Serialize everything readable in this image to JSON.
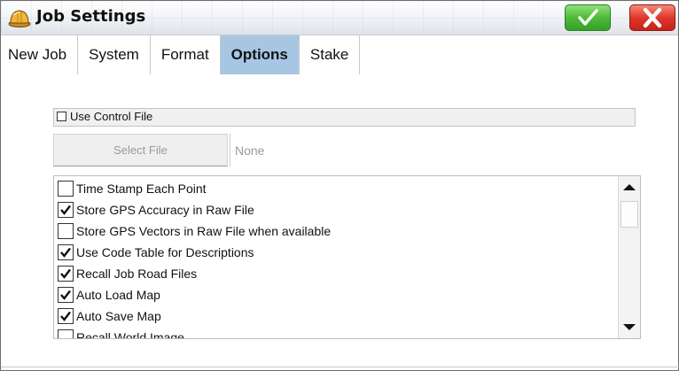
{
  "window": {
    "title": "Job Settings",
    "app_icon": "hard-hat-icon",
    "ok_icon": "checkmark-icon",
    "cancel_icon": "close-x-icon",
    "colors": {
      "ok": "#4fbb36",
      "cancel": "#e0372b",
      "active_tab": "#a7c6e3"
    }
  },
  "tabs": [
    {
      "label": "New Job",
      "active": false
    },
    {
      "label": "System",
      "active": false
    },
    {
      "label": "Format",
      "active": false
    },
    {
      "label": "Options",
      "active": true
    },
    {
      "label": "Stake",
      "active": false
    }
  ],
  "control_file": {
    "label": "Use Control File",
    "checked": false,
    "select_label": "Select File",
    "file_value": "None"
  },
  "options": [
    {
      "label": "Time Stamp Each Point",
      "checked": false
    },
    {
      "label": "Store GPS Accuracy in Raw File",
      "checked": true
    },
    {
      "label": "Store GPS Vectors in Raw File when available",
      "checked": false
    },
    {
      "label": "Use Code Table for Descriptions",
      "checked": true
    },
    {
      "label": "Recall Job Road Files",
      "checked": true
    },
    {
      "label": "Auto Load Map",
      "checked": true
    },
    {
      "label": "Auto Save Map",
      "checked": true
    },
    {
      "label": "Recall World Image",
      "checked": false
    }
  ],
  "scrollbar": {
    "up_icon": "scroll-up-arrow-icon",
    "down_icon": "scroll-down-arrow-icon"
  }
}
